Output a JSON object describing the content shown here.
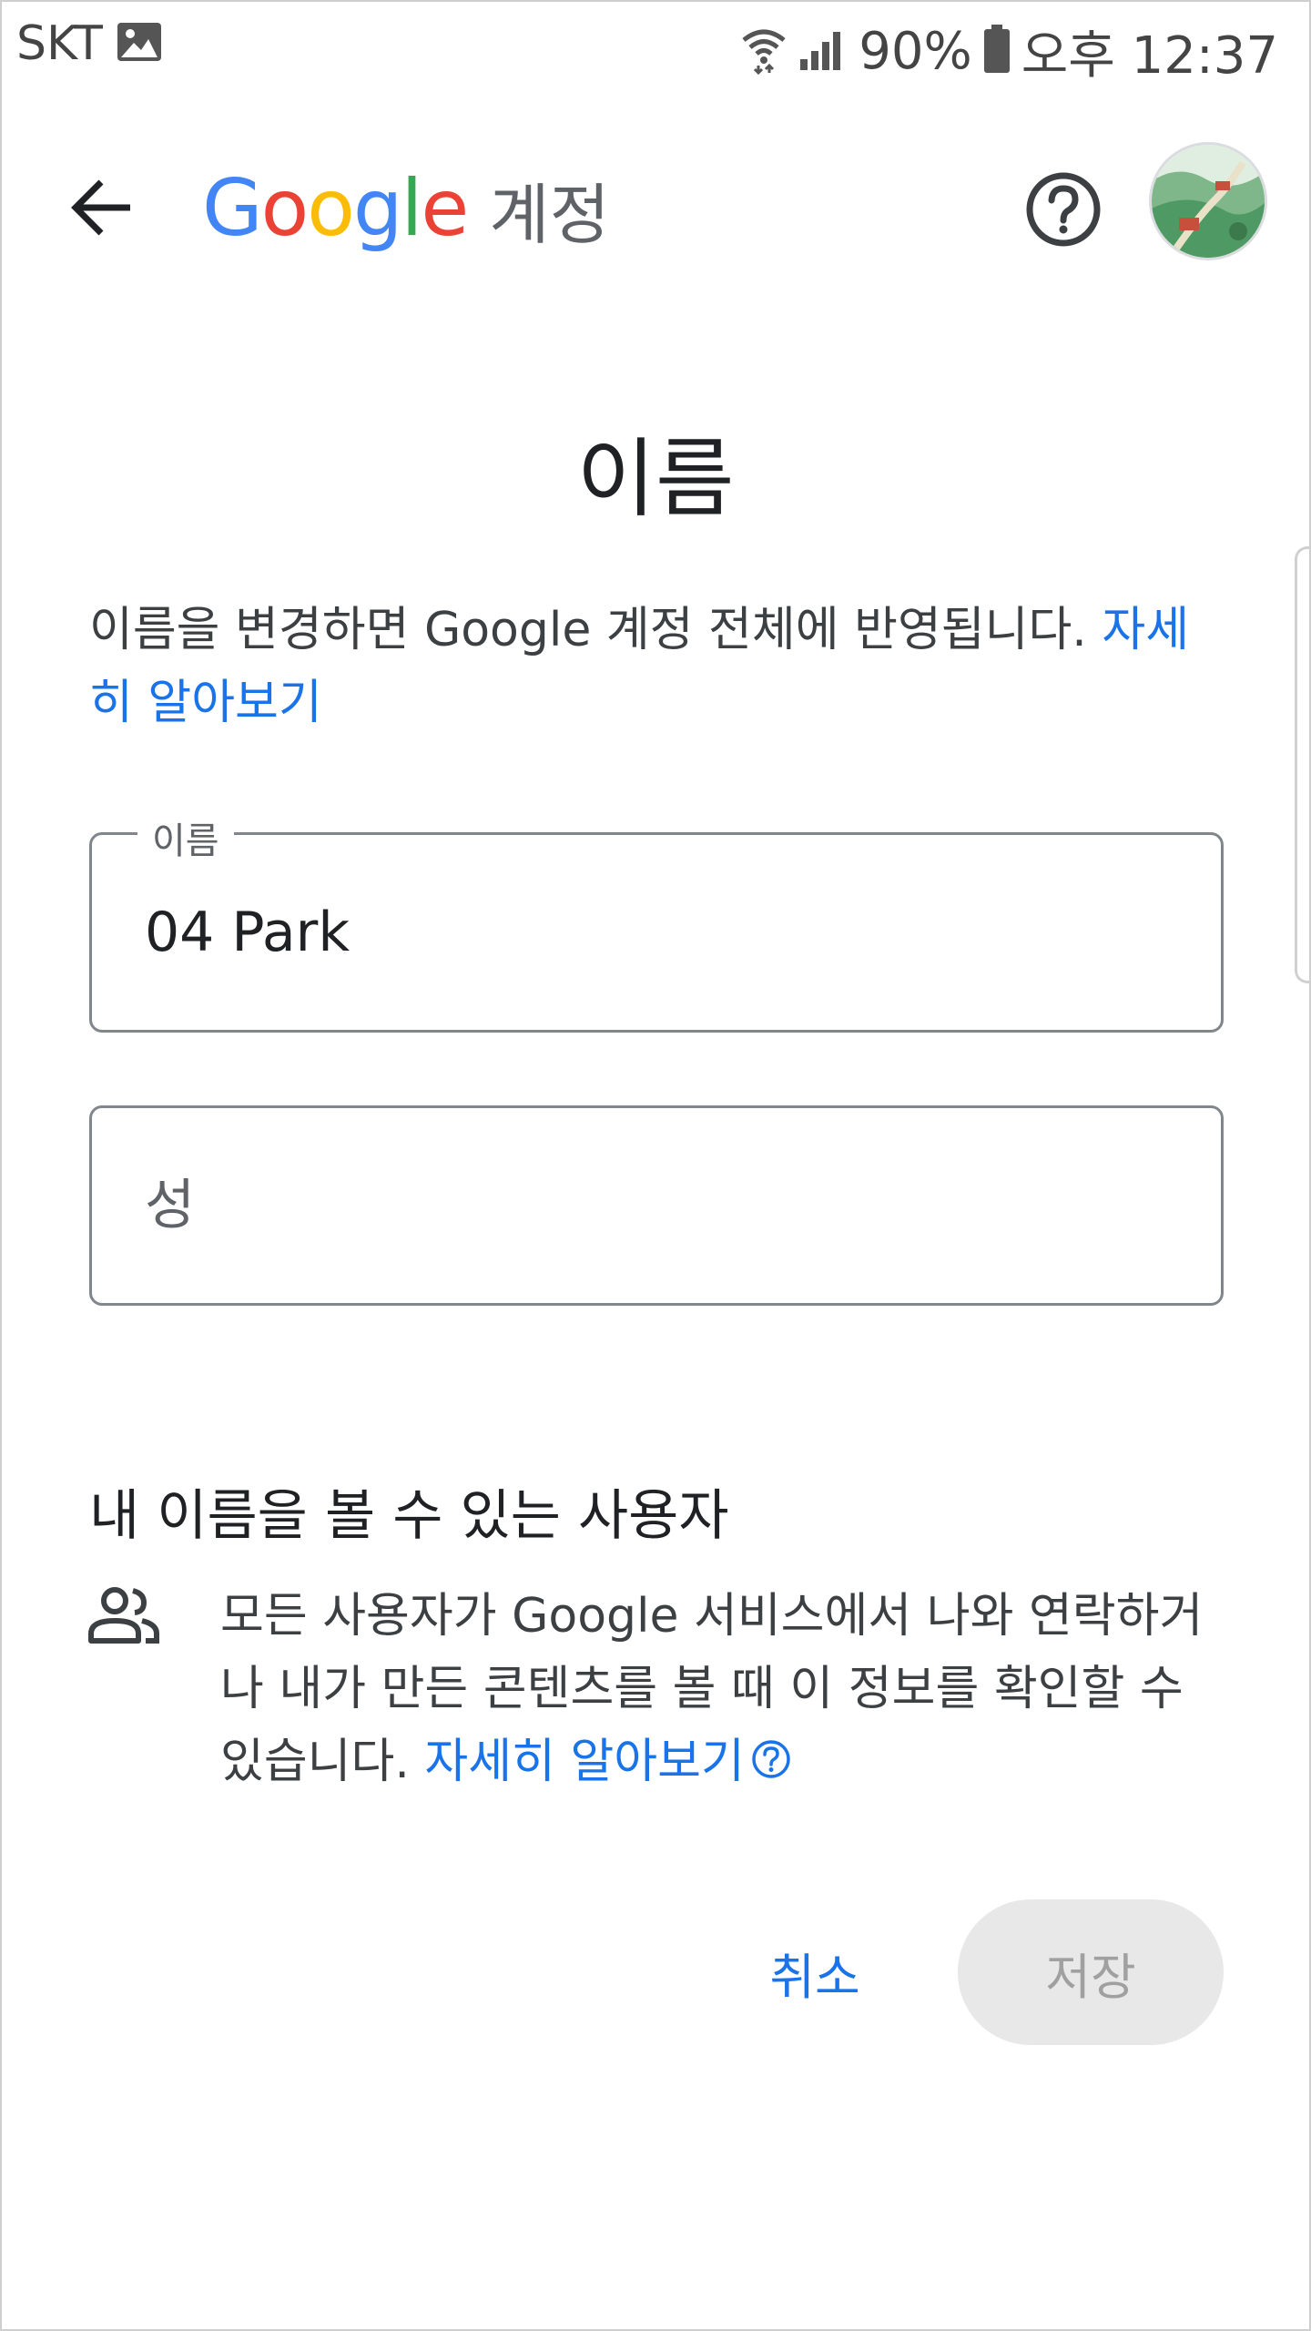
{
  "status_bar": {
    "carrier": "SKT",
    "battery": "90%",
    "time": "오후 12:37",
    "icons": [
      "image-icon",
      "wifi-icon",
      "signal-icon",
      "battery-icon"
    ]
  },
  "app_bar": {
    "brand_letters": [
      "G",
      "o",
      "o",
      "g",
      "l",
      "e"
    ],
    "brand_colors": [
      "#4285F4",
      "#EA4335",
      "#FBBC05",
      "#4285F4",
      "#34A853",
      "#EA4335"
    ],
    "product": "계정",
    "icons": [
      "back-arrow-icon",
      "help-icon"
    ]
  },
  "page": {
    "title": "이름",
    "description": "이름을 변경하면 Google 계정 전체에 반영됩니다. ",
    "learn_more": "자세히 알아보기"
  },
  "form": {
    "first_name_label": "이름",
    "first_name_value": "04 Park",
    "last_name_placeholder": "성"
  },
  "visibility": {
    "title": "내 이름을 볼 수 있는 사용자",
    "text": "모든 사용자가 Google 서비스에서 나와 연락하거나 내가 만든 콘텐츠를 볼 때 이 정보를 확인할 수 있습니다. ",
    "learn_more": "자세히 알아보기",
    "icons": [
      "people-icon",
      "help-circle-icon"
    ]
  },
  "actions": {
    "cancel": "취소",
    "save": "저장"
  },
  "colors": {
    "link": "#1a73e8",
    "save_disabled_bg": "#e8e8e8",
    "save_disabled_text": "#a0a0a0"
  }
}
